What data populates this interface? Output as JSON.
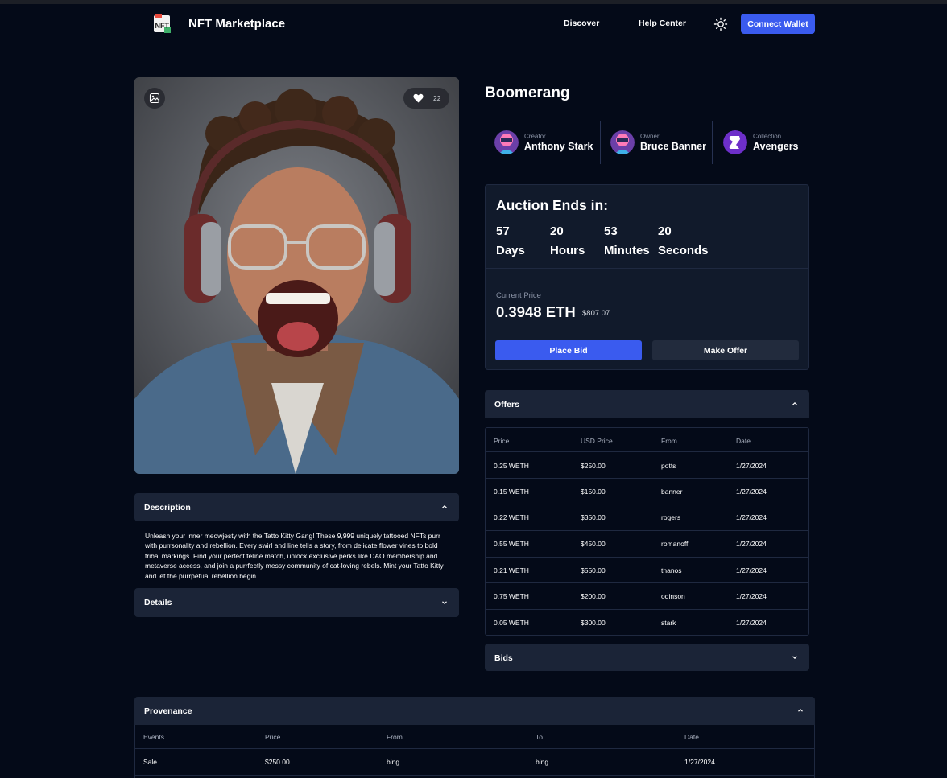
{
  "nav": {
    "brand": "NFT Marketplace",
    "logo_text": "NFT",
    "links": [
      "Discover",
      "Help Center"
    ],
    "connect_label": "Connect Wallet",
    "theme_icon": "sun-icon"
  },
  "media": {
    "image_icon": "image-icon",
    "like_icon": "heart-icon",
    "likes": "22"
  },
  "description": {
    "title": "Description",
    "text": "Unleash your inner meowjesty with the Tatto Kitty Gang! These 9,999 uniquely tattooed NFTs purr with purrsonality and rebellion. Every swirl and line tells a story, from delicate flower vines to bold tribal markings. Find your perfect feline match, unlock exclusive perks like DAO membership and metaverse access, and join a purrfectly messy community of cat-loving rebels. Mint your Tatto Kitty and let the purrpetual rebellion begin."
  },
  "details": {
    "title": "Details"
  },
  "nft": {
    "title": "Boomerang",
    "creator": {
      "role": "Creator",
      "name": "Anthony Stark"
    },
    "owner": {
      "role": "Owner",
      "name": "Bruce Banner"
    },
    "collection": {
      "role": "Collection",
      "name": "Avengers"
    }
  },
  "auction": {
    "title": "Auction Ends in:",
    "countdown": [
      {
        "value": "57",
        "unit": "Days"
      },
      {
        "value": "20",
        "unit": "Hours"
      },
      {
        "value": "53",
        "unit": "Minutes"
      },
      {
        "value": "20",
        "unit": "Seconds"
      }
    ],
    "current_price_label": "Current Price",
    "current_price": "0.3948 ETH",
    "current_price_usd": "$807.07",
    "place_bid": "Place Bid",
    "make_offer": "Make Offer"
  },
  "offers": {
    "title": "Offers",
    "columns": [
      "Price",
      "USD Price",
      "From",
      "Date"
    ],
    "rows": [
      [
        "0.25 WETH",
        "$250.00",
        "potts",
        "1/27/2024"
      ],
      [
        "0.15 WETH",
        "$150.00",
        "banner",
        "1/27/2024"
      ],
      [
        "0.22 WETH",
        "$350.00",
        "rogers",
        "1/27/2024"
      ],
      [
        "0.55 WETH",
        "$450.00",
        "romanoff",
        "1/27/2024"
      ],
      [
        "0.21 WETH",
        "$550.00",
        "thanos",
        "1/27/2024"
      ],
      [
        "0.75 WETH",
        "$200.00",
        "odinson",
        "1/27/2024"
      ],
      [
        "0.05 WETH",
        "$300.00",
        "stark",
        "1/27/2024"
      ]
    ]
  },
  "bids": {
    "title": "Bids"
  },
  "provenance": {
    "title": "Provenance",
    "columns": [
      "Events",
      "Price",
      "From",
      "To",
      "Date"
    ],
    "rows": [
      [
        "Sale",
        "$250.00",
        "bing",
        "bing",
        "1/27/2024"
      ]
    ]
  }
}
